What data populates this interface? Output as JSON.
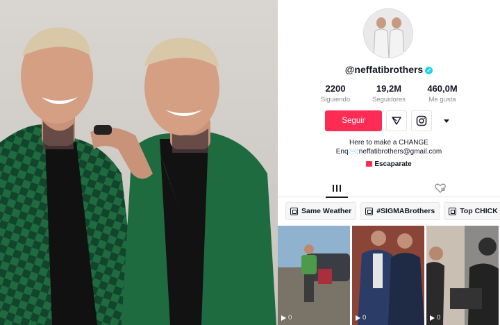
{
  "profile": {
    "username": "@neffatibrothers",
    "verified": true,
    "stats": [
      {
        "value": "2200",
        "label": "Siguiendo"
      },
      {
        "value": "19,2M",
        "label": "Seguidores"
      },
      {
        "value": "460,0M",
        "label": "Me gusta"
      }
    ],
    "follow_label": "Seguir",
    "bio_line1": "Here to make a CHANGE",
    "bio_line2": "Enq✉️:neffatibrothers@gmail.com",
    "showcase_label": "Escaparate"
  },
  "tabs": [
    {
      "icon": "videos-grid-icon",
      "active": true
    },
    {
      "icon": "liked-heart-icon",
      "active": false
    }
  ],
  "playlists": [
    {
      "label": "Same Weather"
    },
    {
      "label": "#SIGMABrothers"
    },
    {
      "label": "Top CHICK"
    }
  ],
  "videos": [
    {
      "views": "0"
    },
    {
      "views": "0"
    },
    {
      "views": "0"
    }
  ],
  "colors": {
    "accent": "#fe2c55",
    "verified": "#20d5ec",
    "jacket_green": "#1e6b3f",
    "text": "#161823",
    "muted": "#8a8b91"
  }
}
